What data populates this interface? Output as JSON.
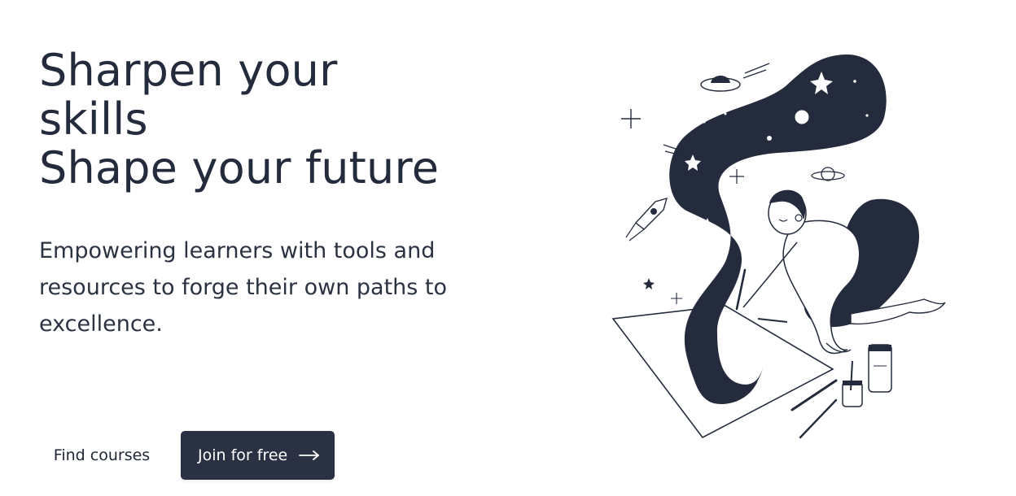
{
  "hero": {
    "title_lines": [
      "Sharpen your",
      "skills",
      "Shape your future"
    ],
    "subtitle_lines": [
      "Empowering learners with tools and",
      "resources to forge their own paths to",
      "excellence."
    ]
  },
  "actions": {
    "find_courses_label": "Find courses",
    "join_label": "Join for free",
    "join_icon": "arrow-right-icon"
  },
  "illustration": {
    "icon": "painter-galaxy-illustration"
  },
  "colors": {
    "text_primary": "#232b3c",
    "button_bg": "#2a3142",
    "button_text": "#ffffff",
    "background": "#ffffff"
  }
}
